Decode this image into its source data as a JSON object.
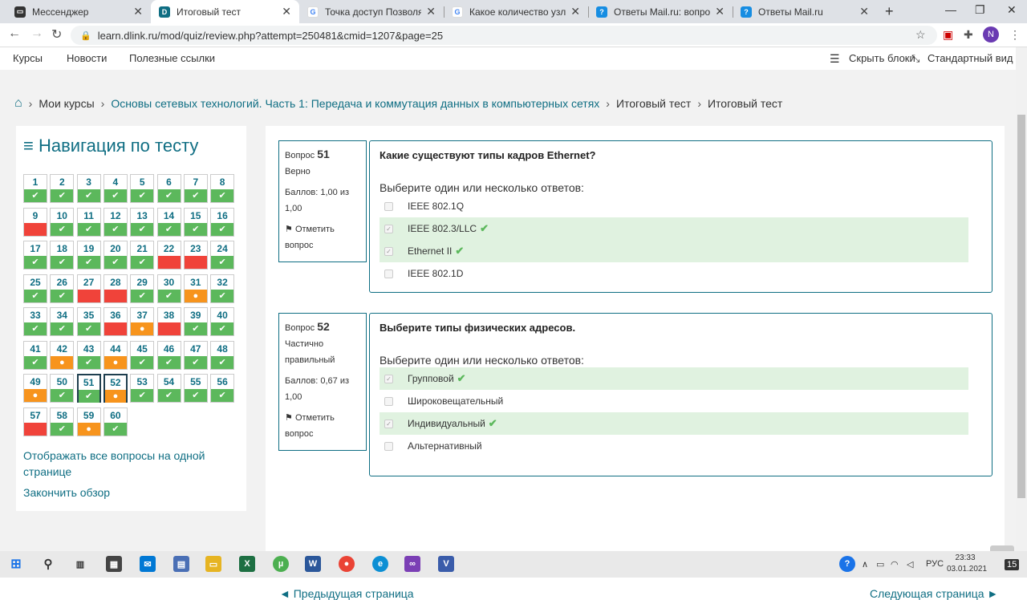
{
  "browser": {
    "tabs": [
      {
        "title": "Мессенджер",
        "icon": "messenger-icon",
        "color": "#333333"
      },
      {
        "title": "Итоговый тест",
        "icon": "dlink-icon",
        "color": "#0f6e83"
      },
      {
        "title": "Точка доступ Позволяет об",
        "icon": "google-icon",
        "color": "#4285f4"
      },
      {
        "title": "Какое количество узлов до",
        "icon": "google-icon",
        "color": "#4285f4"
      },
      {
        "title": "Ответы Mail.ru: вопрос",
        "icon": "mailru-icon",
        "color": "#168de2"
      },
      {
        "title": "Ответы Mail.ru",
        "icon": "mailru-icon",
        "color": "#168de2"
      }
    ],
    "url": "learn.dlink.ru/mod/quiz/review.php?attempt=250481&cmid=1207&page=25",
    "avatar_letter": "N"
  },
  "topnav": {
    "courses": "Курсы",
    "news": "Новости",
    "links": "Полезные ссылки",
    "hide_blocks": "Скрыть блоки",
    "std_view": "Стандартный вид"
  },
  "breadcrumb": {
    "my_courses": "Мои курсы",
    "course": "Основы сетевых технологий. Часть 1: Передача и коммутация данных в компьютерных сетях",
    "item1": "Итоговый тест",
    "item2": "Итоговый тест"
  },
  "quiznav": {
    "title": "Навигация по тесту",
    "questions": [
      {
        "n": "1",
        "s": "correct"
      },
      {
        "n": "2",
        "s": "correct"
      },
      {
        "n": "3",
        "s": "correct"
      },
      {
        "n": "4",
        "s": "correct"
      },
      {
        "n": "5",
        "s": "correct"
      },
      {
        "n": "6",
        "s": "correct"
      },
      {
        "n": "7",
        "s": "correct"
      },
      {
        "n": "8",
        "s": "correct"
      },
      {
        "n": "9",
        "s": "wrong"
      },
      {
        "n": "10",
        "s": "correct"
      },
      {
        "n": "11",
        "s": "correct"
      },
      {
        "n": "12",
        "s": "correct"
      },
      {
        "n": "13",
        "s": "correct"
      },
      {
        "n": "14",
        "s": "correct"
      },
      {
        "n": "15",
        "s": "correct"
      },
      {
        "n": "16",
        "s": "correct"
      },
      {
        "n": "17",
        "s": "correct"
      },
      {
        "n": "18",
        "s": "correct"
      },
      {
        "n": "19",
        "s": "correct"
      },
      {
        "n": "20",
        "s": "correct"
      },
      {
        "n": "21",
        "s": "correct"
      },
      {
        "n": "22",
        "s": "wrong"
      },
      {
        "n": "23",
        "s": "wrong"
      },
      {
        "n": "24",
        "s": "correct"
      },
      {
        "n": "25",
        "s": "correct"
      },
      {
        "n": "26",
        "s": "correct"
      },
      {
        "n": "27",
        "s": "wrong"
      },
      {
        "n": "28",
        "s": "wrong"
      },
      {
        "n": "29",
        "s": "correct"
      },
      {
        "n": "30",
        "s": "correct"
      },
      {
        "n": "31",
        "s": "partial"
      },
      {
        "n": "32",
        "s": "correct"
      },
      {
        "n": "33",
        "s": "correct"
      },
      {
        "n": "34",
        "s": "correct"
      },
      {
        "n": "35",
        "s": "correct"
      },
      {
        "n": "36",
        "s": "wrong"
      },
      {
        "n": "37",
        "s": "partial"
      },
      {
        "n": "38",
        "s": "wrong"
      },
      {
        "n": "39",
        "s": "correct"
      },
      {
        "n": "40",
        "s": "correct"
      },
      {
        "n": "41",
        "s": "correct"
      },
      {
        "n": "42",
        "s": "partial"
      },
      {
        "n": "43",
        "s": "correct"
      },
      {
        "n": "44",
        "s": "partial"
      },
      {
        "n": "45",
        "s": "correct"
      },
      {
        "n": "46",
        "s": "correct"
      },
      {
        "n": "47",
        "s": "correct"
      },
      {
        "n": "48",
        "s": "correct"
      },
      {
        "n": "49",
        "s": "partial"
      },
      {
        "n": "50",
        "s": "correct"
      },
      {
        "n": "51",
        "s": "correct",
        "cur": true
      },
      {
        "n": "52",
        "s": "partial",
        "cur": true
      },
      {
        "n": "53",
        "s": "correct"
      },
      {
        "n": "54",
        "s": "correct"
      },
      {
        "n": "55",
        "s": "correct"
      },
      {
        "n": "56",
        "s": "correct"
      },
      {
        "n": "57",
        "s": "wrong"
      },
      {
        "n": "58",
        "s": "correct"
      },
      {
        "n": "59",
        "s": "partial"
      },
      {
        "n": "60",
        "s": "correct"
      }
    ],
    "show_all": "Отображать все вопросы на одной странице",
    "finish": "Закончить обзор",
    "colors": {
      "correct": "#5cb85c",
      "wrong": "#f0433a",
      "partial": "#f7941d"
    }
  },
  "questions": [
    {
      "label": "Вопрос",
      "number": "51",
      "state": "Верно",
      "marks": "Баллов: 1,00 из 1,00",
      "flag": "Отметить вопрос",
      "text": "Какие существуют типы кадров Ethernet?",
      "prompt": "Выберите один или несколько ответов:",
      "answers": [
        {
          "text": "IEEE 802.1Q",
          "checked": false,
          "correct": false
        },
        {
          "text": "IEEE 802.3/LLC",
          "checked": true,
          "correct": true
        },
        {
          "text": "Ethernet II",
          "checked": true,
          "correct": true
        },
        {
          "text": "IEEE 802.1D",
          "checked": false,
          "correct": false
        }
      ]
    },
    {
      "label": "Вопрос",
      "number": "52",
      "state": "Частично правильный",
      "marks": "Баллов: 0,67 из 1,00",
      "flag": "Отметить вопрос",
      "text": "Выберите типы физических адресов.",
      "prompt": "Выберите один или несколько ответов:",
      "answers": [
        {
          "text": "Групповой",
          "checked": true,
          "correct": true
        },
        {
          "text": "Широковещательный",
          "checked": false,
          "correct": false
        },
        {
          "text": "Индивидуальный",
          "checked": true,
          "correct": true
        },
        {
          "text": "Альтернативный",
          "checked": false,
          "correct": false
        }
      ]
    }
  ],
  "pager": {
    "prev": "◄ Предыдущая страница",
    "next": "Следующая страница ►"
  },
  "taskbar": {
    "lang": "РУС",
    "time": "23:33",
    "date": "03.01.2021",
    "notif": "15"
  }
}
